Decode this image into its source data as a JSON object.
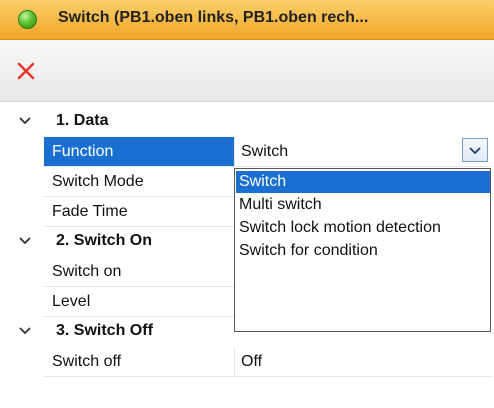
{
  "window": {
    "title": "Switch (PB1.oben links, PB1.oben rech...",
    "status_color": "#4cb825"
  },
  "toolbar": {
    "delete_icon": "close-x-icon",
    "delete_color": "#e8392c"
  },
  "sections": [
    {
      "title": "1. Data",
      "properties": [
        {
          "name": "Function",
          "value": "Switch",
          "selected": true
        },
        {
          "name": "Switch Mode",
          "value": ""
        },
        {
          "name": "Fade Time",
          "value": ""
        }
      ]
    },
    {
      "title": "2. Switch On",
      "properties": [
        {
          "name": "Switch on",
          "value": ""
        },
        {
          "name": "Level",
          "value": ""
        }
      ]
    },
    {
      "title": "3. Switch Off",
      "properties": [
        {
          "name": "Switch off",
          "value": "Off"
        }
      ]
    }
  ],
  "function_dropdown": {
    "selected": "Switch",
    "options": [
      "Switch",
      "Multi switch",
      "Switch lock motion detection",
      "Switch for condition"
    ]
  },
  "colors": {
    "title_bar": "#f3b13a",
    "selection": "#1a6fd1"
  }
}
